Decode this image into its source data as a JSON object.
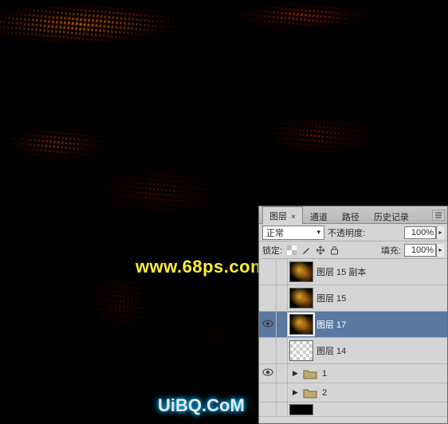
{
  "watermarks": {
    "site1": "www.68ps.com",
    "site2": "UiBQ.CoM"
  },
  "panel": {
    "tabs": {
      "layers": "图层",
      "channels": "通道",
      "paths": "路径",
      "history": "历史记录"
    },
    "blend_mode": "正常",
    "opacity_label": "不透明度:",
    "opacity_value": "100%",
    "lock_label": "锁定:",
    "fill_label": "填充:",
    "fill_value": "100%",
    "layers": [
      {
        "visible": false,
        "name": "图层 15 副本",
        "thumb": "golden"
      },
      {
        "visible": false,
        "name": "图层 15",
        "thumb": "golden"
      },
      {
        "visible": true,
        "name": "图层 17",
        "thumb": "golden",
        "selected": true
      },
      {
        "visible": false,
        "name": "图层 14",
        "thumb": "checker"
      },
      {
        "visible": true,
        "name": "1",
        "group": true
      },
      {
        "visible": false,
        "name": "2",
        "group": true
      }
    ]
  }
}
